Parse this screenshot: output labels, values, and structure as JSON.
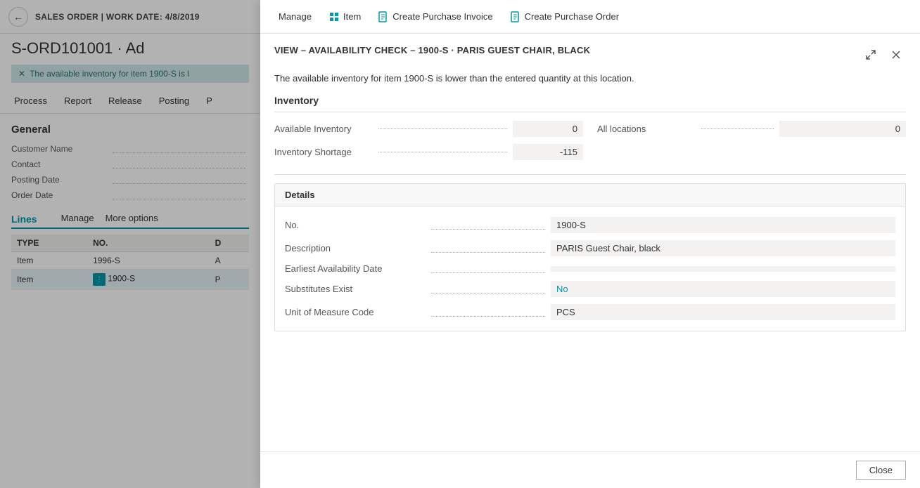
{
  "background": {
    "topbar": {
      "back_label": "←",
      "title": "SALES ORDER | WORK DATE: 4/8/2019"
    },
    "doc_title": "S-ORD101001 · Ad",
    "notification": "The available inventory for item 1900-S is l",
    "nav": {
      "items": [
        "Process",
        "Report",
        "Release",
        "Posting",
        "P"
      ]
    },
    "general_title": "General",
    "fields": [
      {
        "label": "Customer Name"
      },
      {
        "label": "Contact"
      },
      {
        "label": "Posting Date"
      },
      {
        "label": "Order Date"
      }
    ],
    "lines_section": {
      "tab_label": "Lines",
      "manage_label": "Manage",
      "more_options_label": "More options",
      "table": {
        "columns": [
          "TYPE",
          "NO.",
          "D"
        ],
        "rows": [
          {
            "type": "Item",
            "no": "1996-S",
            "d": "A",
            "selected": false,
            "has_dots": false
          },
          {
            "type": "Item",
            "no": "1900-S",
            "d": "P",
            "selected": true,
            "has_dots": true
          }
        ]
      }
    }
  },
  "modal": {
    "actionbar": {
      "manage_label": "Manage",
      "item_label": "Item",
      "create_purchase_invoice_label": "Create Purchase Invoice",
      "create_purchase_order_label": "Create Purchase Order",
      "item_icon": "📦",
      "invoice_icon": "🧾",
      "order_icon": "📋"
    },
    "title": "VIEW – AVAILABILITY CHECK – 1900-S · PARIS GUEST CHAIR, BLACK",
    "warning_text": "The available inventory for item 1900-S is lower than the entered quantity at this location.",
    "inventory": {
      "section_title": "Inventory",
      "available_inventory_label": "Available Inventory",
      "available_inventory_value": "0",
      "all_locations_label": "All locations",
      "all_locations_value": "0",
      "inventory_shortage_label": "Inventory Shortage",
      "inventory_shortage_value": "-115"
    },
    "details": {
      "section_title": "Details",
      "fields": [
        {
          "label": "No.",
          "value": "1900-S",
          "style": "normal"
        },
        {
          "label": "Description",
          "value": "PARIS Guest Chair, black",
          "style": "normal"
        },
        {
          "label": "Earliest Availability Date",
          "value": "",
          "style": "normal"
        },
        {
          "label": "Substitutes Exist",
          "value": "No",
          "style": "link"
        },
        {
          "label": "Unit of Measure Code",
          "value": "PCS",
          "style": "normal"
        }
      ]
    },
    "footer": {
      "close_label": "Close"
    }
  }
}
